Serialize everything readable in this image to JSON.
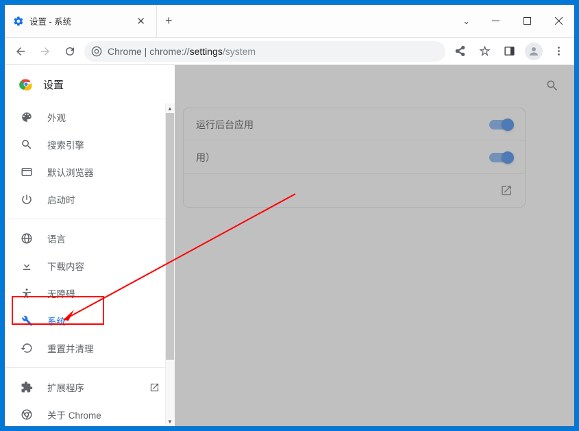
{
  "tab": {
    "title": "设置 - 系统"
  },
  "address": {
    "prefix": "Chrome",
    "host": "chrome://",
    "highlight": "settings",
    "path": "/system"
  },
  "sidebar": {
    "title": "设置",
    "items": [
      {
        "label": "外观",
        "icon": "palette"
      },
      {
        "label": "搜索引擎",
        "icon": "search"
      },
      {
        "label": "默认浏览器",
        "icon": "browser"
      },
      {
        "label": "启动时",
        "icon": "power"
      }
    ],
    "items2": [
      {
        "label": "语言",
        "icon": "globe"
      },
      {
        "label": "下载内容",
        "icon": "download"
      },
      {
        "label": "无障碍",
        "icon": "accessibility"
      },
      {
        "label": "系统",
        "icon": "wrench",
        "active": true
      },
      {
        "label": "重置并清理",
        "icon": "restore"
      }
    ],
    "items3": [
      {
        "label": "扩展程序",
        "icon": "extension",
        "external": true
      },
      {
        "label": "关于 Chrome",
        "icon": "chrome"
      }
    ]
  },
  "card": {
    "row1_suffix": "运行后台应用",
    "row2_suffix": "用）"
  }
}
